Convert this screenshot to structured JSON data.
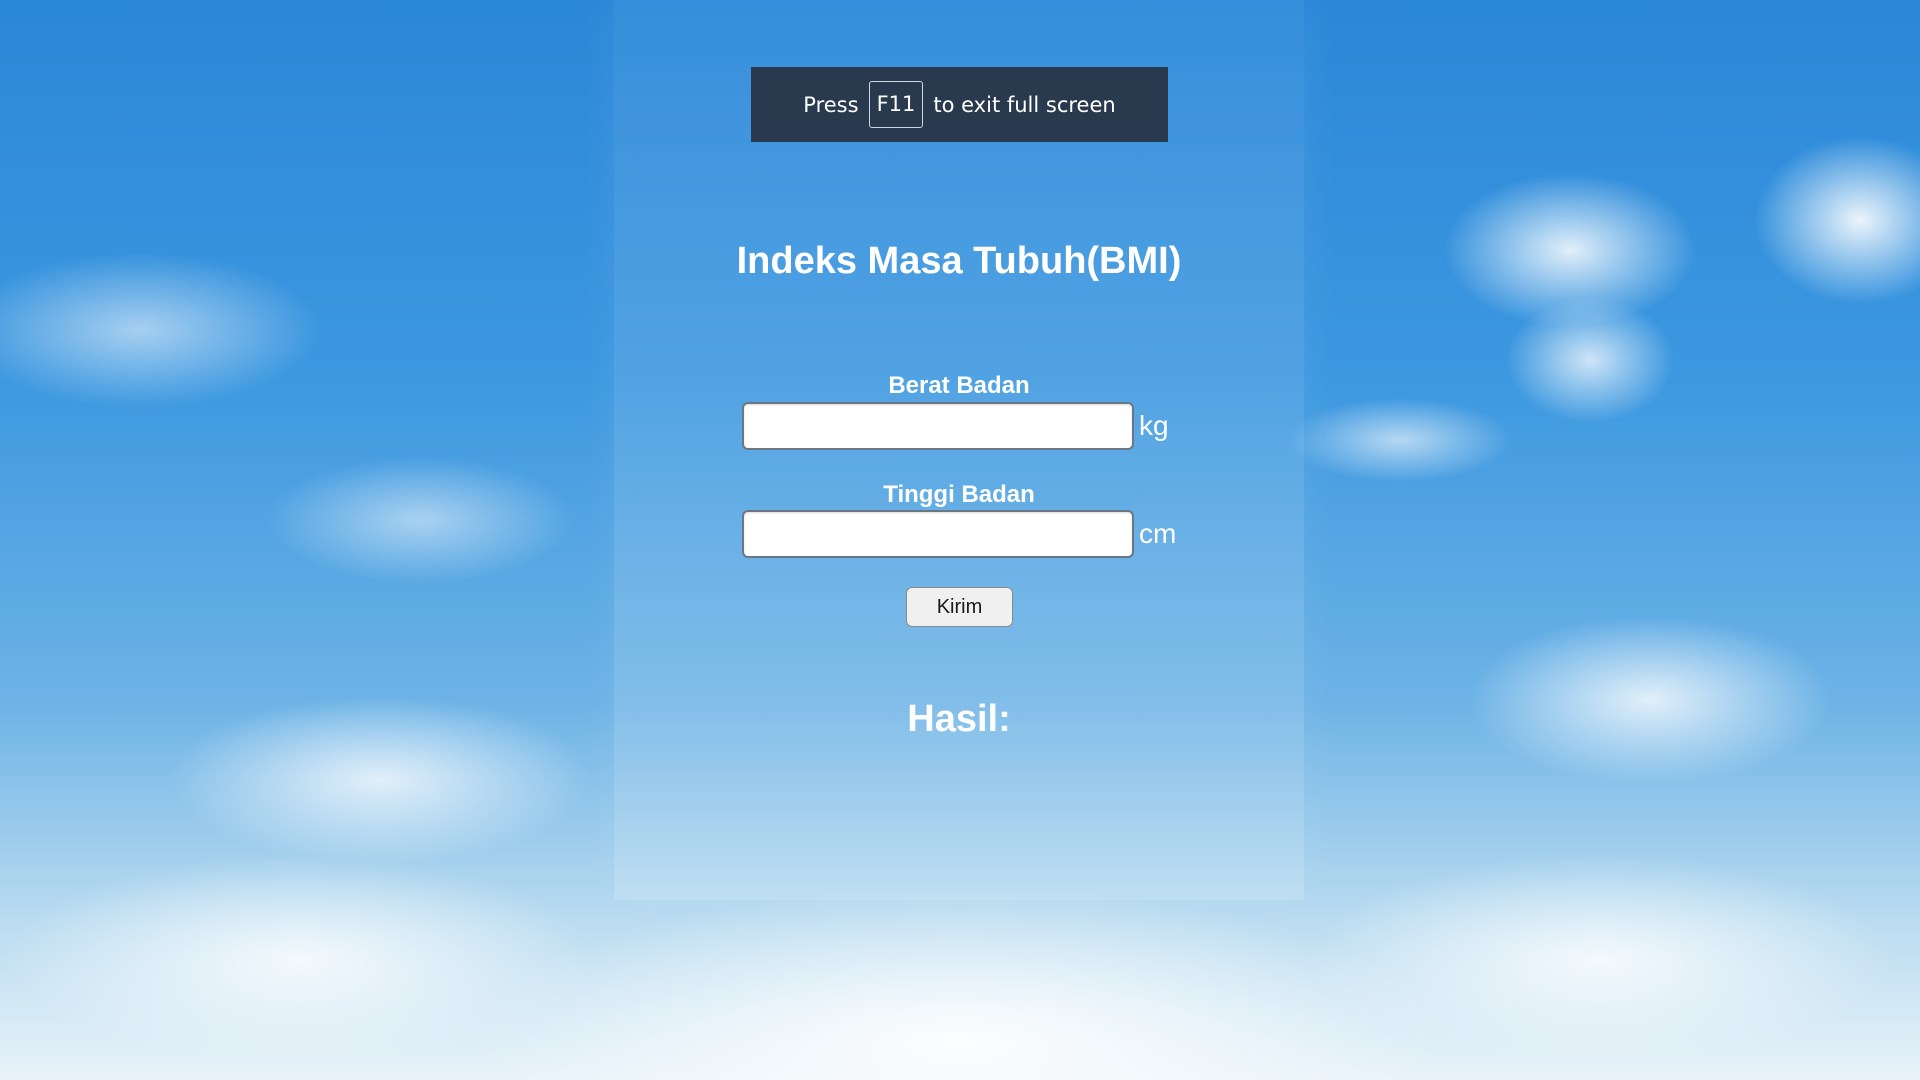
{
  "fullscreen_banner": {
    "prefix": "Press",
    "key": "F11",
    "suffix": "to exit full screen"
  },
  "form": {
    "title": "Indeks Masa Tubuh(BMI)",
    "weight_label": "Berat Badan",
    "weight_value": "",
    "weight_unit": "kg",
    "height_label": "Tinggi Badan",
    "height_value": "",
    "height_unit": "cm",
    "submit_label": "Kirim"
  },
  "result": {
    "heading": "Hasil:"
  }
}
